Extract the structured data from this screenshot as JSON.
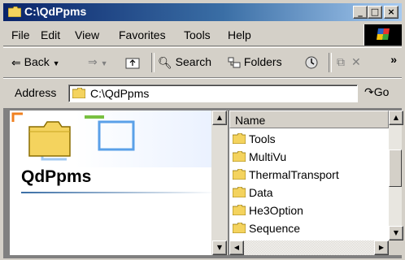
{
  "window": {
    "title": "C:\\QdPpms"
  },
  "title_buttons": [
    "_",
    "□",
    "×"
  ],
  "menu": [
    "File",
    "Edit",
    "View",
    "Favorites",
    "Tools",
    "Help"
  ],
  "toolbar": {
    "back": "Back",
    "search": "Search",
    "folders": "Folders"
  },
  "address": {
    "label": "Address",
    "value": "C:\\QdPpms",
    "go": "Go"
  },
  "left_pane": {
    "title": "QdPpms"
  },
  "list": {
    "column_name": "Name",
    "items": [
      "Tools",
      "MultiVu",
      "ThermalTransport",
      "Data",
      "He3Option",
      "Sequence"
    ]
  },
  "colors": {
    "title_start": "#0a246a",
    "title_end": "#a6caf0",
    "folder": "#f4d35e",
    "chrome": "#d4d0c8"
  }
}
